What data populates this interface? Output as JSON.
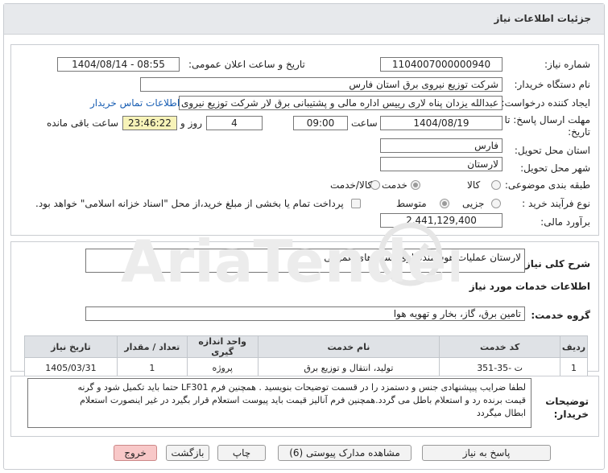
{
  "header": {
    "title": "جزئیات اطلاعات نیاز"
  },
  "info": {
    "need_number_label": "شماره نیاز:",
    "need_number": "1104007000000940",
    "announce_label": "تاریخ و ساعت اعلان عمومی:",
    "announce_value": "1404/08/14 - 08:55",
    "buyer_label": "نام دستگاه خریدار:",
    "buyer_value": "شرکت توزیع نیروی برق استان فارس",
    "creator_label": "ایجاد کننده درخواست:",
    "creator_value": "عبدالله یزدان پناه لاری رییس اداره مالی و پشتیبانی برق لار شرکت توزیع نیروی برق",
    "contact_link": "اطلاعات تماس خریدار",
    "deadline_label": "مهلت ارسال پاسخ: تا",
    "deadline_label2": "تاریخ:",
    "deadline_date": "1404/08/19",
    "time_label": "ساعت",
    "deadline_time": "09:00",
    "days_value": "4",
    "days_label": "روز و",
    "remaining_value": "23:46:22",
    "remaining_label": "ساعت باقی مانده",
    "province_label": "استان محل تحویل:",
    "province_value": "فارس",
    "city_label": "شهر محل تحویل:",
    "city_value": "لارستان",
    "category_label": "طبقه بندی موضوعی:",
    "category_options": [
      "کالا",
      "خدمت",
      "کالا/خدمت"
    ],
    "category_selected": "خدمت",
    "process_label": "نوع فرآیند خرید :",
    "process_options": [
      "جزیی",
      "متوسط"
    ],
    "process_selected": "متوسط",
    "payment_note": "پرداخت تمام یا بخشی از مبلغ خرید،از محل \"اسناد خزانه اسلامی\" خواهد بود.",
    "budget_label": "برآورد مالی:",
    "budget_value": "2,441,129,400"
  },
  "summary": {
    "label": "شرح کلی نیاز:",
    "value": "لارستان عملیات هوشمندسازی پست های عمومی"
  },
  "services": {
    "section_title": "اطلاعات خدمات مورد نیاز",
    "group_label": "گروه خدمت:",
    "group_value": "تامین برق، گاز، بخار و تهویه هوا",
    "columns": [
      "ردیف",
      "کد خدمت",
      "نام خدمت",
      "واحد اندازه گیری",
      "تعداد / مقدار",
      "تاریخ نیاز"
    ],
    "rows": [
      [
        "1",
        "ت -35-351",
        "تولید، انتقال و توزیع برق",
        "پروژه",
        "1",
        "1405/03/31"
      ]
    ]
  },
  "buyer_notes": {
    "label": "توضیحات",
    "label2": "خریدار:",
    "line1": "لطفا ضرایب پیپشنهادی جنس و دستمزد را در قسمت توضیحات بنویسید . همچنین فرم LF301 حتما باید تکمیل شود و گرنه",
    "line2": "قیمت برنده رد و استعلام باطل می گردد.همچنین فرم آنالیز قیمت باید پیوست استعلام قرار بگیرد در غیر اینصورت استعلام",
    "line3": "ابطال میگردد"
  },
  "buttons": {
    "reply": "پاسخ به نیاز",
    "attachments": "مشاهده مدارک پیوستی (6)",
    "print": "چاپ",
    "back": "بازگشت",
    "exit": "خروج"
  },
  "colors": {
    "accent": "#1a5fb4",
    "highlight": "#f7f3b8",
    "exit_button": "#f8c8c8"
  }
}
